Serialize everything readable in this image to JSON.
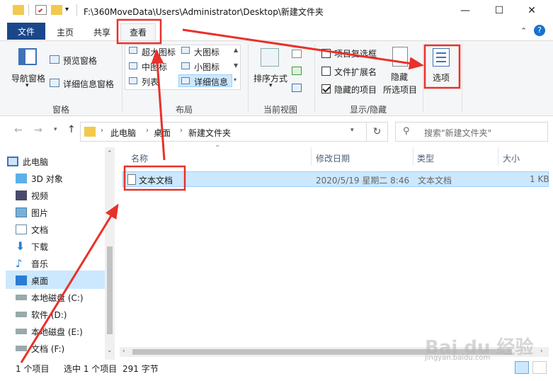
{
  "window": {
    "title": "F:\\360MoveData\\Users\\Administrator\\Desktop\\新建文件夹",
    "minimize": "—",
    "maximize": "☐",
    "close": "✕"
  },
  "tabs": {
    "file": "文件",
    "home": "主页",
    "share": "共享",
    "view": "查看"
  },
  "ribbon": {
    "panes": {
      "nav_pane": "导航窗格",
      "preview_pane": "预览窗格",
      "details_pane": "详细信息窗格",
      "group": "窗格"
    },
    "layout": {
      "xl_icons": "超大图标",
      "large_icons": "大图标",
      "medium_icons": "中图标",
      "small_icons": "小图标",
      "list": "列表",
      "details": "详细信息",
      "group": "布局"
    },
    "current_view": {
      "sort_by": "排序方式",
      "group": "当前视图"
    },
    "show_hide": {
      "item_checkboxes": "项目复选框",
      "file_extensions": "文件扩展名",
      "hidden_items": "隐藏的项目",
      "hide_selected_1": "隐藏",
      "hide_selected_2": "所选项目",
      "group": "显示/隐藏",
      "item_checkboxes_checked": false,
      "file_extensions_checked": false,
      "hidden_items_checked": true
    },
    "options": "选项"
  },
  "address": {
    "crumbs": [
      "此电脑",
      "桌面",
      "新建文件夹"
    ],
    "search_placeholder": "搜索\"新建文件夹\""
  },
  "nav": {
    "items": [
      {
        "label": "此电脑",
        "icon": "computer-icon"
      },
      {
        "label": "3D 对象",
        "icon": "3d-objects-icon"
      },
      {
        "label": "视频",
        "icon": "video-icon"
      },
      {
        "label": "图片",
        "icon": "pictures-icon"
      },
      {
        "label": "文档",
        "icon": "documents-icon"
      },
      {
        "label": "下载",
        "icon": "download-icon"
      },
      {
        "label": "音乐",
        "icon": "music-icon"
      },
      {
        "label": "桌面",
        "icon": "desktop-icon"
      },
      {
        "label": "本地磁盘 (C:)",
        "icon": "drive-icon"
      },
      {
        "label": "软件 (D:)",
        "icon": "drive-icon"
      },
      {
        "label": "本地磁盘 (E:)",
        "icon": "drive-icon"
      },
      {
        "label": "文档 (F:)",
        "icon": "drive-icon"
      }
    ]
  },
  "columns": {
    "name": "名称",
    "modified": "修改日期",
    "type": "类型",
    "size": "大小"
  },
  "files": [
    {
      "name": "文本文档",
      "modified": "2020/5/19 星期二 8:46",
      "type": "文本文档",
      "size": "1 KB"
    }
  ],
  "status": {
    "count": "1 个项目",
    "selected": "选中 1 个项目",
    "size": "291 字节"
  },
  "watermark": {
    "brand": "Bai du 经验",
    "url": "jingyan.baidu.com"
  },
  "colors": {
    "file_tab": "#19478a",
    "selection": "#cce8ff",
    "annotation": "#e8312a"
  }
}
